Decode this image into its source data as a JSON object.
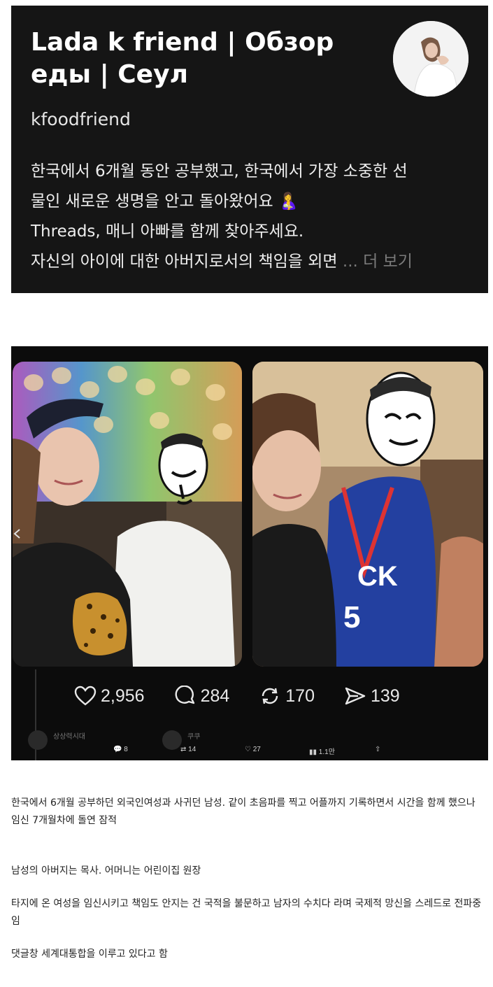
{
  "profile": {
    "name": "Lada k friend | Обзор еды | Сеул",
    "handle": "kfoodfriend",
    "bio_lines": [
      "한국에서 6개월 동안 공부했고, 한국에서 가장 소중한 선",
      "물인 새로운 생명을 안고 돌아왔어요 🤱",
      "Threads, 매니 아빠를 함께 찾아주세요.",
      "자신의 아이에 대한 아버지로서의 책임을 외면"
    ],
    "more_label": "... 더 보기"
  },
  "post": {
    "stats": {
      "likes": "2,956",
      "comments": "284",
      "reposts": "170",
      "shares": "139"
    },
    "faint_row": {
      "user1": "상상력시대",
      "user2": "쿠쿠",
      "stat_comments": "8",
      "stat_reposts": "14",
      "stat_likes": "27",
      "stat_views": "1.1만"
    }
  },
  "article": {
    "p1": "한국에서 6개월 공부하던 외국인여성과 사귀던 남성. 같이 초음파를 찍고 어플까지 기록하면서 시간을 함께 했으나 임신 7개월차에 돌연 잠적",
    "p2": "남성의 아버지는 목사. 어머니는 어린이집 원장",
    "p3": "타지에 온 여성을 임신시키고 책임도 안지는 건 국적을 불문하고 남자의 수치다 라며 국제적 망신을 스레드로 전파중임",
    "p4": "댓글창 세계대통합을 이루고 있다고 함"
  },
  "icons": {
    "like": "heart-icon",
    "comment": "comment-bubble-icon",
    "repost": "repost-arrows-icon",
    "share": "send-arrow-icon"
  },
  "colors": {
    "card_bg": "#151515",
    "post_bg": "#0c0c0c",
    "more_text": "#7a7a7a"
  }
}
